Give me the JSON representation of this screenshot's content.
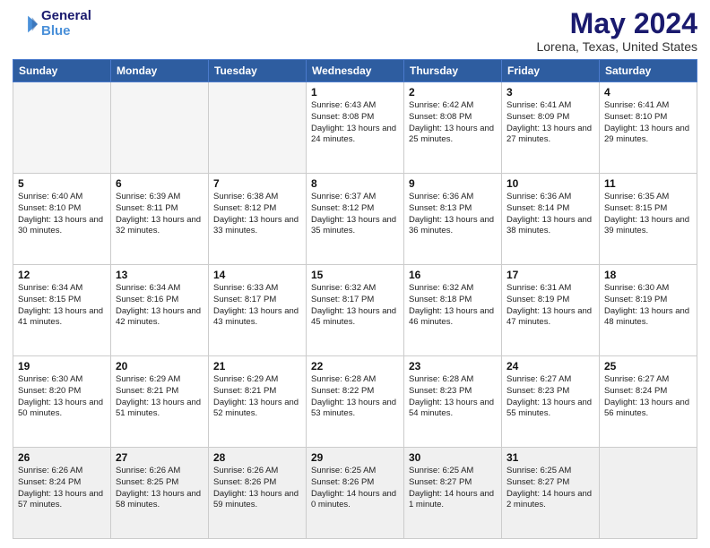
{
  "header": {
    "logo_general": "General",
    "logo_blue": "Blue",
    "month_title": "May 2024",
    "location": "Lorena, Texas, United States"
  },
  "calendar": {
    "days_of_week": [
      "Sunday",
      "Monday",
      "Tuesday",
      "Wednesday",
      "Thursday",
      "Friday",
      "Saturday"
    ],
    "weeks": [
      [
        {
          "day": "",
          "info": ""
        },
        {
          "day": "",
          "info": ""
        },
        {
          "day": "",
          "info": ""
        },
        {
          "day": "1",
          "info": "Sunrise: 6:43 AM\nSunset: 8:08 PM\nDaylight: 13 hours and 24 minutes."
        },
        {
          "day": "2",
          "info": "Sunrise: 6:42 AM\nSunset: 8:08 PM\nDaylight: 13 hours and 25 minutes."
        },
        {
          "day": "3",
          "info": "Sunrise: 6:41 AM\nSunset: 8:09 PM\nDaylight: 13 hours and 27 minutes."
        },
        {
          "day": "4",
          "info": "Sunrise: 6:41 AM\nSunset: 8:10 PM\nDaylight: 13 hours and 29 minutes."
        }
      ],
      [
        {
          "day": "5",
          "info": "Sunrise: 6:40 AM\nSunset: 8:10 PM\nDaylight: 13 hours and 30 minutes."
        },
        {
          "day": "6",
          "info": "Sunrise: 6:39 AM\nSunset: 8:11 PM\nDaylight: 13 hours and 32 minutes."
        },
        {
          "day": "7",
          "info": "Sunrise: 6:38 AM\nSunset: 8:12 PM\nDaylight: 13 hours and 33 minutes."
        },
        {
          "day": "8",
          "info": "Sunrise: 6:37 AM\nSunset: 8:12 PM\nDaylight: 13 hours and 35 minutes."
        },
        {
          "day": "9",
          "info": "Sunrise: 6:36 AM\nSunset: 8:13 PM\nDaylight: 13 hours and 36 minutes."
        },
        {
          "day": "10",
          "info": "Sunrise: 6:36 AM\nSunset: 8:14 PM\nDaylight: 13 hours and 38 minutes."
        },
        {
          "day": "11",
          "info": "Sunrise: 6:35 AM\nSunset: 8:15 PM\nDaylight: 13 hours and 39 minutes."
        }
      ],
      [
        {
          "day": "12",
          "info": "Sunrise: 6:34 AM\nSunset: 8:15 PM\nDaylight: 13 hours and 41 minutes."
        },
        {
          "day": "13",
          "info": "Sunrise: 6:34 AM\nSunset: 8:16 PM\nDaylight: 13 hours and 42 minutes."
        },
        {
          "day": "14",
          "info": "Sunrise: 6:33 AM\nSunset: 8:17 PM\nDaylight: 13 hours and 43 minutes."
        },
        {
          "day": "15",
          "info": "Sunrise: 6:32 AM\nSunset: 8:17 PM\nDaylight: 13 hours and 45 minutes."
        },
        {
          "day": "16",
          "info": "Sunrise: 6:32 AM\nSunset: 8:18 PM\nDaylight: 13 hours and 46 minutes."
        },
        {
          "day": "17",
          "info": "Sunrise: 6:31 AM\nSunset: 8:19 PM\nDaylight: 13 hours and 47 minutes."
        },
        {
          "day": "18",
          "info": "Sunrise: 6:30 AM\nSunset: 8:19 PM\nDaylight: 13 hours and 48 minutes."
        }
      ],
      [
        {
          "day": "19",
          "info": "Sunrise: 6:30 AM\nSunset: 8:20 PM\nDaylight: 13 hours and 50 minutes."
        },
        {
          "day": "20",
          "info": "Sunrise: 6:29 AM\nSunset: 8:21 PM\nDaylight: 13 hours and 51 minutes."
        },
        {
          "day": "21",
          "info": "Sunrise: 6:29 AM\nSunset: 8:21 PM\nDaylight: 13 hours and 52 minutes."
        },
        {
          "day": "22",
          "info": "Sunrise: 6:28 AM\nSunset: 8:22 PM\nDaylight: 13 hours and 53 minutes."
        },
        {
          "day": "23",
          "info": "Sunrise: 6:28 AM\nSunset: 8:23 PM\nDaylight: 13 hours and 54 minutes."
        },
        {
          "day": "24",
          "info": "Sunrise: 6:27 AM\nSunset: 8:23 PM\nDaylight: 13 hours and 55 minutes."
        },
        {
          "day": "25",
          "info": "Sunrise: 6:27 AM\nSunset: 8:24 PM\nDaylight: 13 hours and 56 minutes."
        }
      ],
      [
        {
          "day": "26",
          "info": "Sunrise: 6:26 AM\nSunset: 8:24 PM\nDaylight: 13 hours and 57 minutes."
        },
        {
          "day": "27",
          "info": "Sunrise: 6:26 AM\nSunset: 8:25 PM\nDaylight: 13 hours and 58 minutes."
        },
        {
          "day": "28",
          "info": "Sunrise: 6:26 AM\nSunset: 8:26 PM\nDaylight: 13 hours and 59 minutes."
        },
        {
          "day": "29",
          "info": "Sunrise: 6:25 AM\nSunset: 8:26 PM\nDaylight: 14 hours and 0 minutes."
        },
        {
          "day": "30",
          "info": "Sunrise: 6:25 AM\nSunset: 8:27 PM\nDaylight: 14 hours and 1 minute."
        },
        {
          "day": "31",
          "info": "Sunrise: 6:25 AM\nSunset: 8:27 PM\nDaylight: 14 hours and 2 minutes."
        },
        {
          "day": "",
          "info": ""
        }
      ]
    ]
  }
}
